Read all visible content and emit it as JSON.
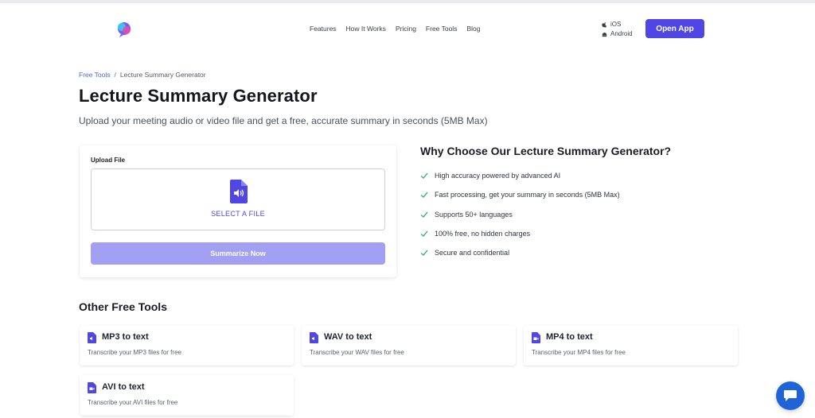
{
  "colors": {
    "accent": "#4f46e5",
    "accent_light": "#a39ff3",
    "check": "#3fb27f",
    "link": "#4a6bd6",
    "chat": "#1e64d8"
  },
  "header": {
    "logo_icon": "brand-logo-icon",
    "nav": [
      "Features",
      "How It Works",
      "Pricing",
      "Free Tools",
      "Blog"
    ],
    "platforms": {
      "ios": "iOS",
      "android": "Android"
    },
    "open_app": "Open App"
  },
  "breadcrumb": {
    "root": "Free Tools",
    "separator": "/",
    "current": "Lecture Summary Generator"
  },
  "page": {
    "title": "Lecture Summary Generator",
    "subtitle": "Upload your meeting audio or video file and get a free, accurate summary in seconds (5MB Max)"
  },
  "upload": {
    "label": "Upload File",
    "select_file": "SELECT A FILE",
    "summarize": "Summarize Now",
    "icon": "audio-file-icon"
  },
  "why": {
    "title": "Why Choose Our Lecture Summary Generator?",
    "features": [
      "High accuracy powered by advanced AI",
      "Fast processing, get your summary in seconds (5MB Max)",
      "Supports 50+ languages",
      "100% free, no hidden charges",
      "Secure and confidential"
    ]
  },
  "other_tools": {
    "title": "Other Free Tools",
    "items": [
      {
        "name": "MP3 to text",
        "desc": "Transcribe your MP3 files for free",
        "icon": "audio-file-icon"
      },
      {
        "name": "WAV to text",
        "desc": "Transcribe your WAV files for free",
        "icon": "audio-file-icon"
      },
      {
        "name": "MP4 to text",
        "desc": "Transcribe your MP4 files for free",
        "icon": "video-file-icon"
      },
      {
        "name": "AVI to text",
        "desc": "Transcribe your AVI files for free",
        "icon": "video-file-icon"
      }
    ]
  },
  "chat": {
    "icon": "chat-bubble-icon"
  }
}
